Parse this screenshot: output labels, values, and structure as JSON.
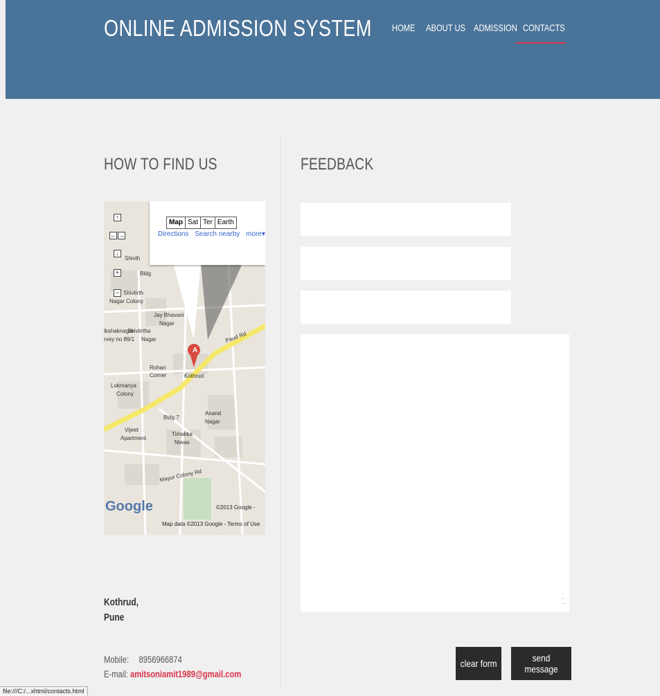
{
  "header": {
    "site_title": "ONLINE ADMISSION SYSTEM",
    "nav": [
      "HOME",
      "ABOUT US",
      "ADMISSION",
      "CONTACTS"
    ],
    "active_nav": "CONTACTS"
  },
  "find_us": {
    "heading": "HOW TO FIND US",
    "map": {
      "types": [
        "Map",
        "Sat",
        "Ter",
        "Earth"
      ],
      "links": [
        "Directions",
        "Search nearby",
        "more▾"
      ],
      "marker": "A",
      "labels": [
        "Shivth",
        "Bldg",
        "Shivtirth",
        "Nagar Colony",
        "Jay Bhavani",
        "Nagar",
        "Paud Rd",
        "Kothrud",
        "Anand",
        "Nagar",
        "Lokmanya",
        "Colony",
        "Rohan",
        "Corner",
        "Vijeet",
        "Apartment",
        "Timakka",
        "Niwas",
        "Mayur Colony Rd",
        "Shivtirtha",
        "Nagar",
        "ikshaknagar",
        "rvey no 89/1",
        "Bldg 7"
      ],
      "google_logo": "Google",
      "copyright_top": "©2013 Google -",
      "copyright_bottom": "Map data ©2013 Google - Terms of Use"
    },
    "address_line1": "Kothrud,",
    "address_line2": "Pune",
    "mobile_label": "Mobile:",
    "mobile_value": "8956966874",
    "email_label": "E-mail:",
    "email_value": "amitsoniamit1989@gmail.com"
  },
  "feedback": {
    "heading": "FEEDBACK",
    "clear_label": "clear form",
    "send_label": "send message"
  },
  "statusbar": "file:///C:/...xhtml/contacts.html"
}
